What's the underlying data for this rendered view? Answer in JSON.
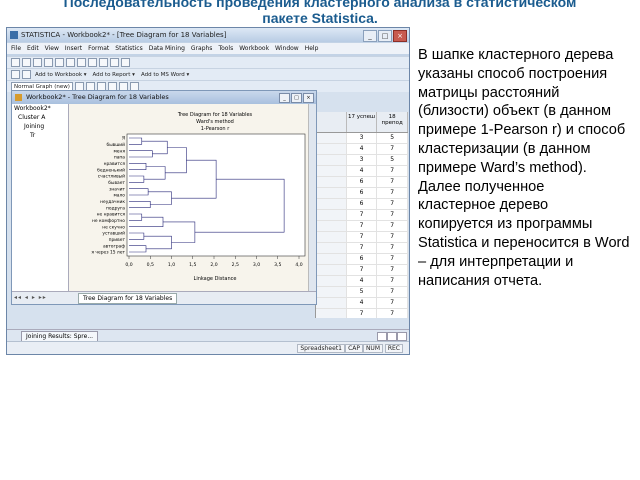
{
  "slide": {
    "title_line1": "Последовательность проведения кластерного анализа в статистическом",
    "title_line2": "пакете Statistica."
  },
  "app": {
    "window_title": "STATISTICA - Workbook2* - [Tree Diagram for 18 Variables]",
    "minimize_glyph": "_",
    "maximize_glyph": "□",
    "close_glyph": "×",
    "menu": [
      "File",
      "Edit",
      "View",
      "Insert",
      "Format",
      "Statistics",
      "Data Mining",
      "Graphs",
      "Tools",
      "Workbook",
      "Window",
      "Help"
    ],
    "toolbar_graph_select": "Normal Graph (new)",
    "toolbar_add_workbook": "Add to Workbook ▾",
    "toolbar_add_report": "Add to Report ▾",
    "toolbar_add_msword": "Add to MS Word ▾",
    "inner_window_title": "Workbook2* - Tree Diagram for 18 Variables",
    "nav_tree": [
      "Workbook2*",
      "Cluster A",
      "Joining",
      "Tr"
    ],
    "tab_label": "Tree Diagram for 18 Variables",
    "tab_nav_glyphs": "◂◂ ◂ ▸ ▸▸",
    "taskbar_item": "Joining Results: Spre...",
    "status": [
      "Spreadsheet1",
      "CAP",
      "NUM",
      "REC"
    ],
    "sheet_headers": [
      "",
      "17 успеш",
      "18 препод"
    ],
    "sheet_rows": [
      [
        "",
        "3",
        "5"
      ],
      [
        "",
        "4",
        "7"
      ],
      [
        "",
        "3",
        "5"
      ],
      [
        "",
        "4",
        "7"
      ],
      [
        "",
        "6",
        "7"
      ],
      [
        "",
        "6",
        "7"
      ],
      [
        "",
        "6",
        "7"
      ],
      [
        "",
        "7",
        "7"
      ],
      [
        "",
        "7",
        "7"
      ],
      [
        "",
        "7",
        "7"
      ],
      [
        "",
        "7",
        "7"
      ],
      [
        "",
        "6",
        "7"
      ],
      [
        "",
        "7",
        "7"
      ],
      [
        "",
        "4",
        "7"
      ],
      [
        "",
        "5",
        "7"
      ],
      [
        "",
        "4",
        "7"
      ],
      [
        "",
        "7",
        "7"
      ],
      [
        "",
        "7",
        "7"
      ],
      [
        "",
        "7",
        "7"
      ]
    ]
  },
  "chart_data": {
    "type": "dendrogram",
    "title_lines": [
      "Tree Diagram for 18 Variables",
      "Ward's method",
      "1-Pearson r"
    ],
    "xlabel": "Linkage Distance",
    "xlim": [
      0,
      4.0
    ],
    "ticks": [
      "0,0",
      "0,5",
      "1,0",
      "1,5",
      "2,0",
      "2,5",
      "3,0",
      "3,5",
      "4,0"
    ],
    "leaves": [
      "Я",
      "бывший",
      "меня",
      "папа",
      "нравится",
      "бедненький",
      "счастливый",
      "бывает",
      "значит",
      "мало",
      "неудачник",
      "подруга",
      "не нравится",
      "не комфортно",
      "не скучно",
      "уставший",
      "привет",
      "автограф",
      "я через 15 лет"
    ],
    "merges": [
      {
        "a": 0,
        "b": 1,
        "h": 0.3
      },
      {
        "a": 2,
        "b": 3,
        "h": 0.55
      },
      {
        "a": "m0",
        "b": "m1",
        "h": 0.9
      },
      {
        "a": 4,
        "b": 5,
        "h": 0.4
      },
      {
        "a": 6,
        "b": 7,
        "h": 0.35
      },
      {
        "a": "m3",
        "b": "m4",
        "h": 0.85
      },
      {
        "a": "m2",
        "b": "m5",
        "h": 1.35
      },
      {
        "a": 8,
        "b": 9,
        "h": 0.45
      },
      {
        "a": 10,
        "b": 11,
        "h": 0.5
      },
      {
        "a": "m7",
        "b": "m8",
        "h": 1.0
      },
      {
        "a": "m6",
        "b": "m9",
        "h": 2.05
      },
      {
        "a": 12,
        "b": 13,
        "h": 0.3
      },
      {
        "a": 14,
        "b": "m11",
        "h": 0.8
      },
      {
        "a": 15,
        "b": 16,
        "h": 0.35
      },
      {
        "a": 17,
        "b": 18,
        "h": 0.4
      },
      {
        "a": "m13",
        "b": "m14",
        "h": 1.0
      },
      {
        "a": "m12",
        "b": "m15",
        "h": 1.55
      },
      {
        "a": "m10",
        "b": "m16",
        "h": 3.65
      }
    ]
  },
  "explanation": {
    "lines": [
      "В шапке кластерного дерева",
      "указаны способ построения",
      "матрицы расстояний",
      "(близости) объект (в данном",
      "примере 1-Pearson r) и способ",
      "кластеризации (в данном",
      "примере Ward’s method).",
      "Далее полученное",
      "кластерное дерево",
      "копируется из программы",
      "Statistica и переносится в Word",
      "– для интерпретации и",
      "написания отчета."
    ]
  }
}
